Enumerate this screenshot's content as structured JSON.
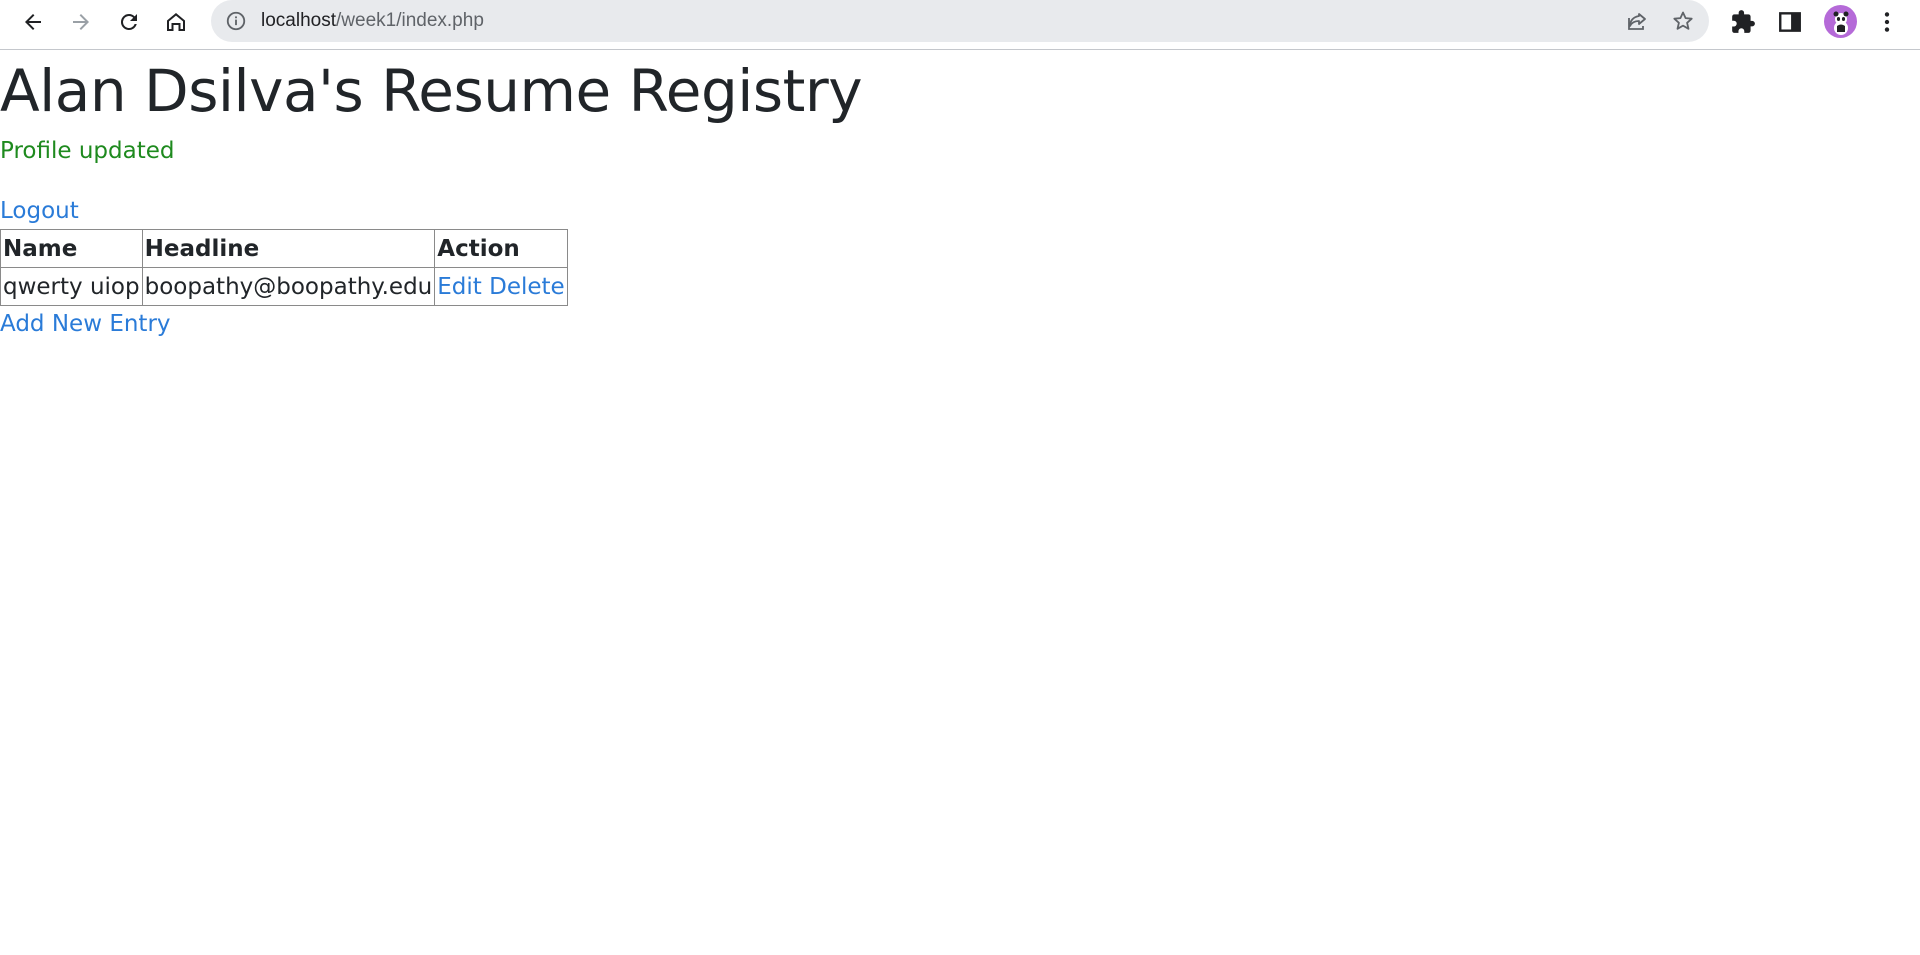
{
  "browser": {
    "url_host": "localhost",
    "url_path": "/week1/index.php",
    "colors": {
      "omnibox_bg": "#e8eaed",
      "avatar_bg": "#b56ad8"
    },
    "icons": [
      "back-icon",
      "forward-icon",
      "reload-icon",
      "home-icon",
      "info-icon",
      "share-icon",
      "star-icon",
      "extensions-icon",
      "side-panel-icon",
      "profile-avatar",
      "menu-icon"
    ]
  },
  "page": {
    "title": "Alan Dsilva's Resume Registry",
    "flash_message": "Profile updated",
    "logout_label": "Logout",
    "add_label": "Add New Entry",
    "table": {
      "headers": [
        "Name",
        "Headline",
        "Action"
      ],
      "rows": [
        {
          "name": "qwerty uiop",
          "headline": "boopathy@boopathy.edu",
          "edit_label": "Edit",
          "delete_label": "Delete"
        }
      ]
    },
    "colors": {
      "link": "#2a7bd8",
      "success": "#1e8a1e",
      "text": "#212529"
    }
  }
}
